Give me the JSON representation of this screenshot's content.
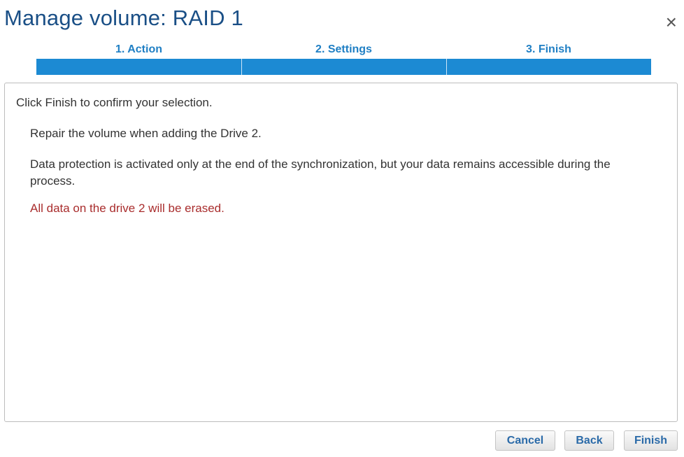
{
  "dialog": {
    "title": "Manage volume: RAID 1",
    "close_symbol": "×"
  },
  "steps": [
    {
      "label": "1. Action"
    },
    {
      "label": "2. Settings"
    },
    {
      "label": "3. Finish"
    }
  ],
  "content": {
    "intro": "Click Finish to confirm your selection.",
    "repair_text": "Repair the volume when adding the Drive 2.",
    "protection_text": "Data protection is activated only at the end of the synchronization, but your data remains accessible during the process.",
    "warning_text": "All data on the drive 2 will be erased."
  },
  "buttons": {
    "cancel": "Cancel",
    "back": "Back",
    "finish": "Finish"
  },
  "colors": {
    "title": "#1a4f86",
    "step_bar": "#1c8ad3",
    "warning": "#a92d2d"
  },
  "icons": {
    "close": "close-icon"
  }
}
